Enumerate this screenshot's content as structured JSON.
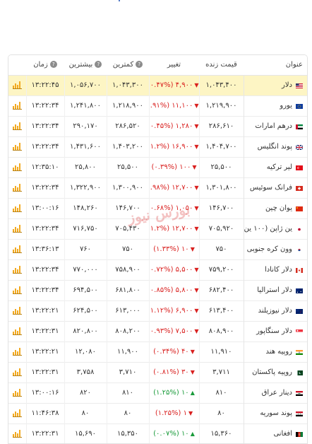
{
  "columns": {
    "title": "عنوان",
    "live": "قیمت زنده",
    "change": "تغییر",
    "low": "کمترین",
    "high": "بیشترین",
    "time": "زمان"
  },
  "watermark": "بورس نیوز",
  "colors": {
    "negative": "#d9201f",
    "positive": "#1a9b3b",
    "highlight": "#fdf5c4",
    "chart": "#f2a91f"
  },
  "rows": [
    {
      "name": "دلار",
      "flag": "us",
      "live": "۱,۰۴۳,۴۰۰",
      "change": "۴,۹۰۰ (۰.۴۷%)",
      "dir": "neg",
      "low": "۱,۰۴۳,۳۰۰",
      "high": "۱,۰۵۶,۷۰۰",
      "time": "۱۳:۲۲:۴۵",
      "hl": true
    },
    {
      "name": "یورو",
      "flag": "eu",
      "live": "۱,۲۱۹,۹۰۰",
      "change": "۱۱,۱۰۰ (۰.۹۱%)",
      "dir": "neg",
      "low": "۱,۲۱۸,۹۰۰",
      "high": "۱,۲۴۱,۸۰۰",
      "time": "۱۳:۲۲:۳۴"
    },
    {
      "name": "درهم امارات",
      "flag": "ae",
      "live": "۲۸۶,۶۱۰",
      "change": "۱,۲۸۰ (۰.۴۵%)",
      "dir": "neg",
      "low": "۲۸۶,۵۲۰",
      "high": "۲۹۰,۱۷۰",
      "time": "۱۳:۲۲:۳۴"
    },
    {
      "name": "پوند انگلیس",
      "flag": "gb",
      "live": "۱,۴۰۴,۷۰۰",
      "change": "۱۶,۹۰۰ (۱.۲%)",
      "dir": "neg",
      "low": "۱,۴۰۳,۲۰۰",
      "high": "۱,۴۳۱,۶۰۰",
      "time": "۱۳:۲۲:۳۴"
    },
    {
      "name": "لیر ترکیه",
      "flag": "tr",
      "live": "۲۵,۵۰۰",
      "change": "۱۰۰ (۰.۳۹%)",
      "dir": "neg",
      "low": "۲۵,۵۰۰",
      "high": "۲۵,۸۰۰",
      "time": "۱۲:۳۵:۱۰"
    },
    {
      "name": "فرانک سوئیس",
      "flag": "ch",
      "live": "۱,۳۰۱,۸۰۰",
      "change": "۱۲,۷۰۰ (۰.۹۸%)",
      "dir": "neg",
      "low": "۱,۳۰۰,۹۰۰",
      "high": "۱,۳۲۲,۹۰۰",
      "time": "۱۳:۲۲:۳۴"
    },
    {
      "name": "یوان چین",
      "flag": "cn",
      "live": "۱۴۶,۷۰۰",
      "change": "۱,۰۵۰ (۰.۶۸%)",
      "dir": "neg",
      "low": "۱۴۶,۷۰۰",
      "high": "۱۴۸,۲۶۰",
      "time": "۱۳:۰۰:۱۶"
    },
    {
      "name": "ین ژاپن (۱۰۰ ین)",
      "flag": "jp",
      "live": "۷۰۵,۹۲۰",
      "change": "۱۲,۷۰۰ (۱.۲%)",
      "dir": "neg",
      "low": "۷۰۵,۴۳۰",
      "high": "۷۱۶,۷۵۰",
      "time": "۱۳:۲۲:۳۴"
    },
    {
      "name": "وون کره جنوبی",
      "flag": "kr",
      "live": "۷۵۰",
      "change": "۱۰ (۱.۳۳%)",
      "dir": "neg",
      "low": "۷۵۰",
      "high": "۷۶۰",
      "time": "۱۳:۳۶:۱۳"
    },
    {
      "name": "دلار کانادا",
      "flag": "ca",
      "live": "۷۵۹,۲۰۰",
      "change": "۵,۵۰۰ (۰.۷۲%)",
      "dir": "neg",
      "low": "۷۵۸,۹۰۰",
      "high": "۷۷۰,۰۰۰",
      "time": "۱۳:۲۲:۳۴"
    },
    {
      "name": "دلار استرالیا",
      "flag": "au",
      "live": "۶۸۲,۴۰۰",
      "change": "۵,۸۰۰ (۰.۸۵%)",
      "dir": "neg",
      "low": "۶۸۱,۸۰۰",
      "high": "۶۹۴,۵۰۰",
      "time": "۱۳:۲۲:۳۴"
    },
    {
      "name": "دلار نیوزیلند",
      "flag": "nz",
      "live": "۶۱۳,۴۰۰",
      "change": "۶,۹۰۰ (۱.۱۲%)",
      "dir": "neg",
      "low": "۶۱۳,۰۰۰",
      "high": "۶۲۴,۵۰۰",
      "time": "۱۳:۲۲:۲۱"
    },
    {
      "name": "دلار سنگاپور",
      "flag": "sg",
      "live": "۸۰۸,۹۰۰",
      "change": "۷,۵۰۰ (۰.۹۳%)",
      "dir": "neg",
      "low": "۸۰۸,۲۰۰",
      "high": "۸۲۰,۸۰۰",
      "time": "۱۳:۲۲:۳۱"
    },
    {
      "name": "روپیه هند",
      "flag": "in",
      "live": "۱۱,۹۱۰",
      "change": "۴۰ (۰.۳۴%)",
      "dir": "neg",
      "low": "۱۱,۹۰۰",
      "high": "۱۲,۰۸۰",
      "time": "۱۳:۲۲:۲۱"
    },
    {
      "name": "روپیه پاکستان",
      "flag": "pk",
      "live": "۳,۷۱۱",
      "change": "۳۰ (۰.۸۱%)",
      "dir": "neg",
      "low": "۳,۷۱۰",
      "high": "۳,۷۵۸",
      "time": "۱۳:۲۲:۳۱"
    },
    {
      "name": "دینار عراق",
      "flag": "iq",
      "live": "۸۱۰",
      "change": "۱۰ (۱.۲۵%)",
      "dir": "pos",
      "low": "۸۱۰",
      "high": "۸۲۰",
      "time": "۱۳:۰۰:۱۶"
    },
    {
      "name": "پوند سوریه",
      "flag": "sy",
      "live": "۸۰",
      "change": "۱ (۱.۲۵%)",
      "dir": "neg",
      "low": "۸۰",
      "high": "۸۰",
      "time": "۱۱:۴۶:۳۸"
    },
    {
      "name": "افغانی",
      "flag": "af",
      "live": "۱۵,۳۶۰",
      "change": "۱۰ (۰.۰۷%)",
      "dir": "pos",
      "low": "۱۵,۳۵۰",
      "high": "۱۵,۶۹۰",
      "time": "۱۳:۲۲:۳۱"
    }
  ]
}
